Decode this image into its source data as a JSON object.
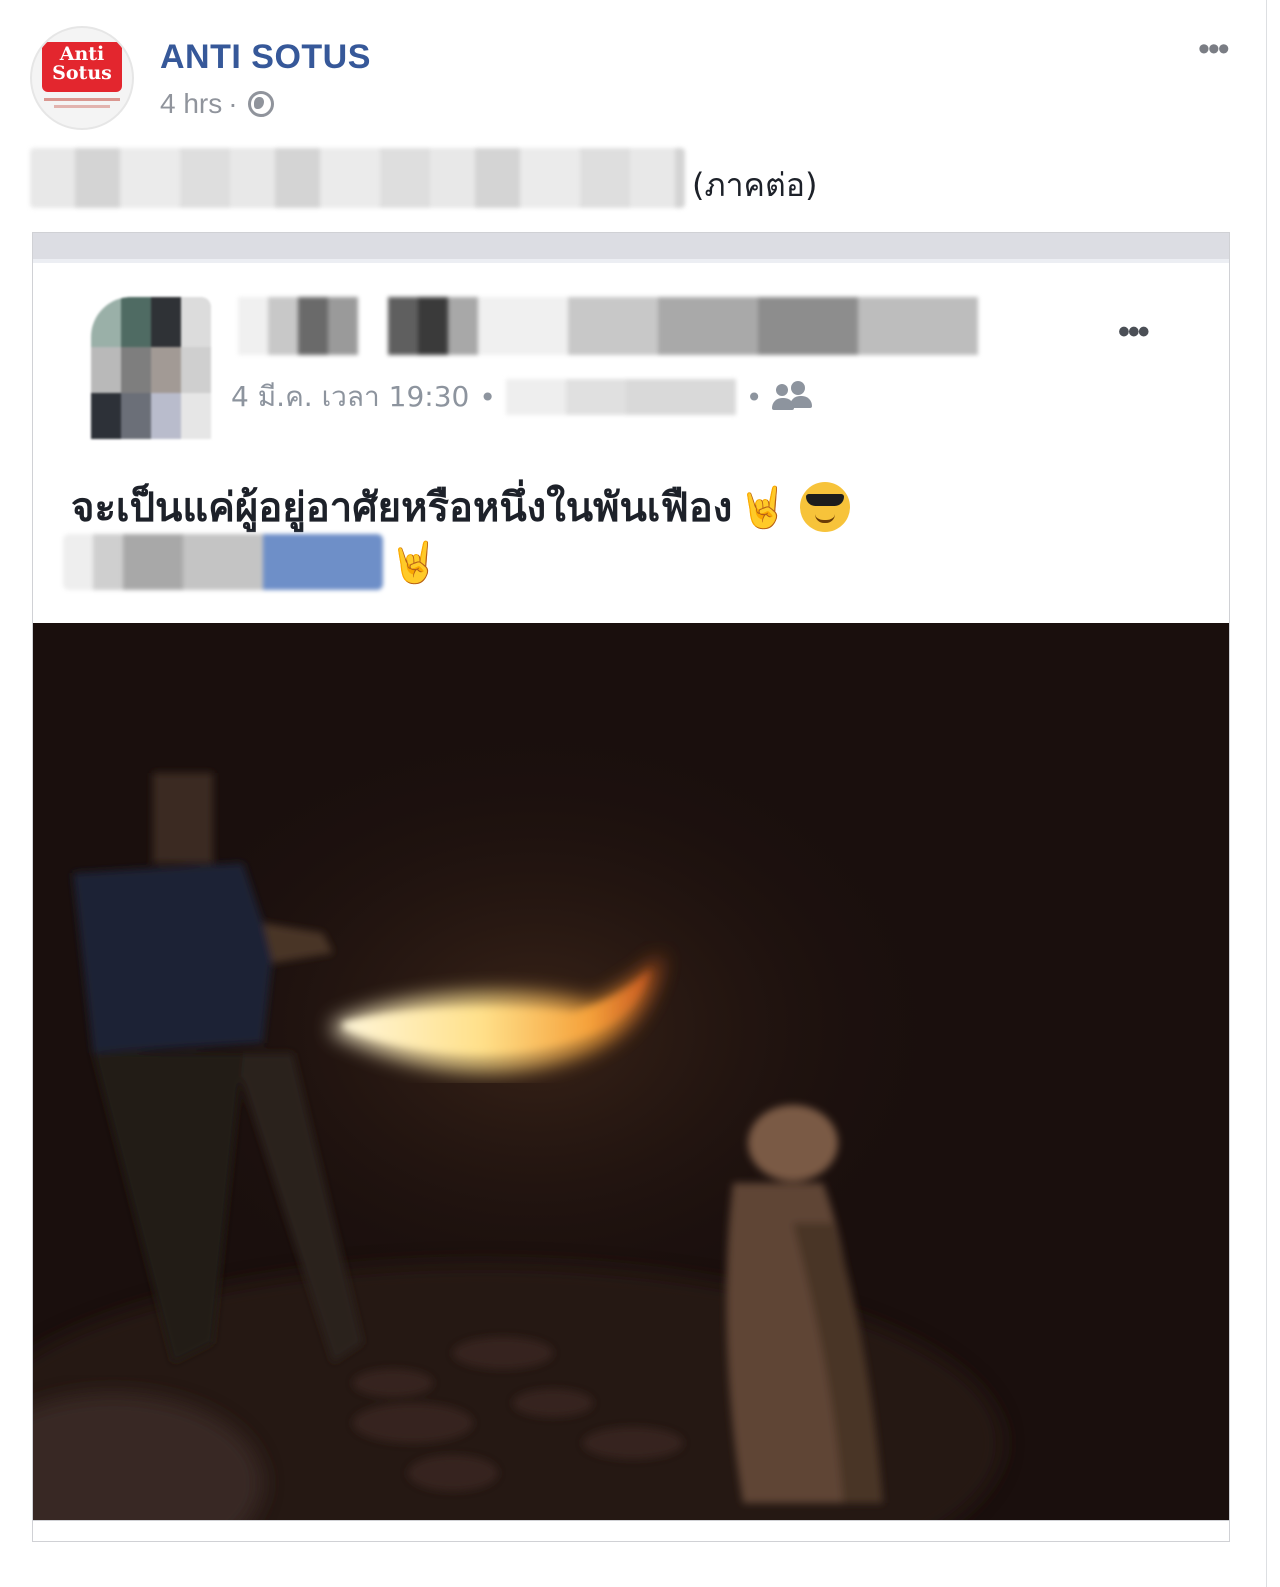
{
  "post": {
    "page_name": "ANTI SOTUS",
    "time": "4 hrs",
    "separator": "·",
    "caption_suffix": "(ภาคต่อ)",
    "more_icon": "more-horizontal-icon",
    "privacy_icon": "globe-icon"
  },
  "avatar": {
    "logo_text_line1": "Anti",
    "logo_text_line2": "Sotus",
    "brand_color": "#e3262e"
  },
  "shared": {
    "meta_date": "4 มี.ค. เวลา 19:30",
    "meta_separator": "•",
    "audience_icon": "friends-icon",
    "text": "จะเป็นแค่ผู้อยู่อาศัยหรือหนึ่งในพันเฟือง",
    "emoji_rock": "🤘",
    "emoji_cool": "sunglasses-emoji"
  },
  "colors": {
    "link": "#365899",
    "meta": "#90949c",
    "text": "#1d2129"
  }
}
